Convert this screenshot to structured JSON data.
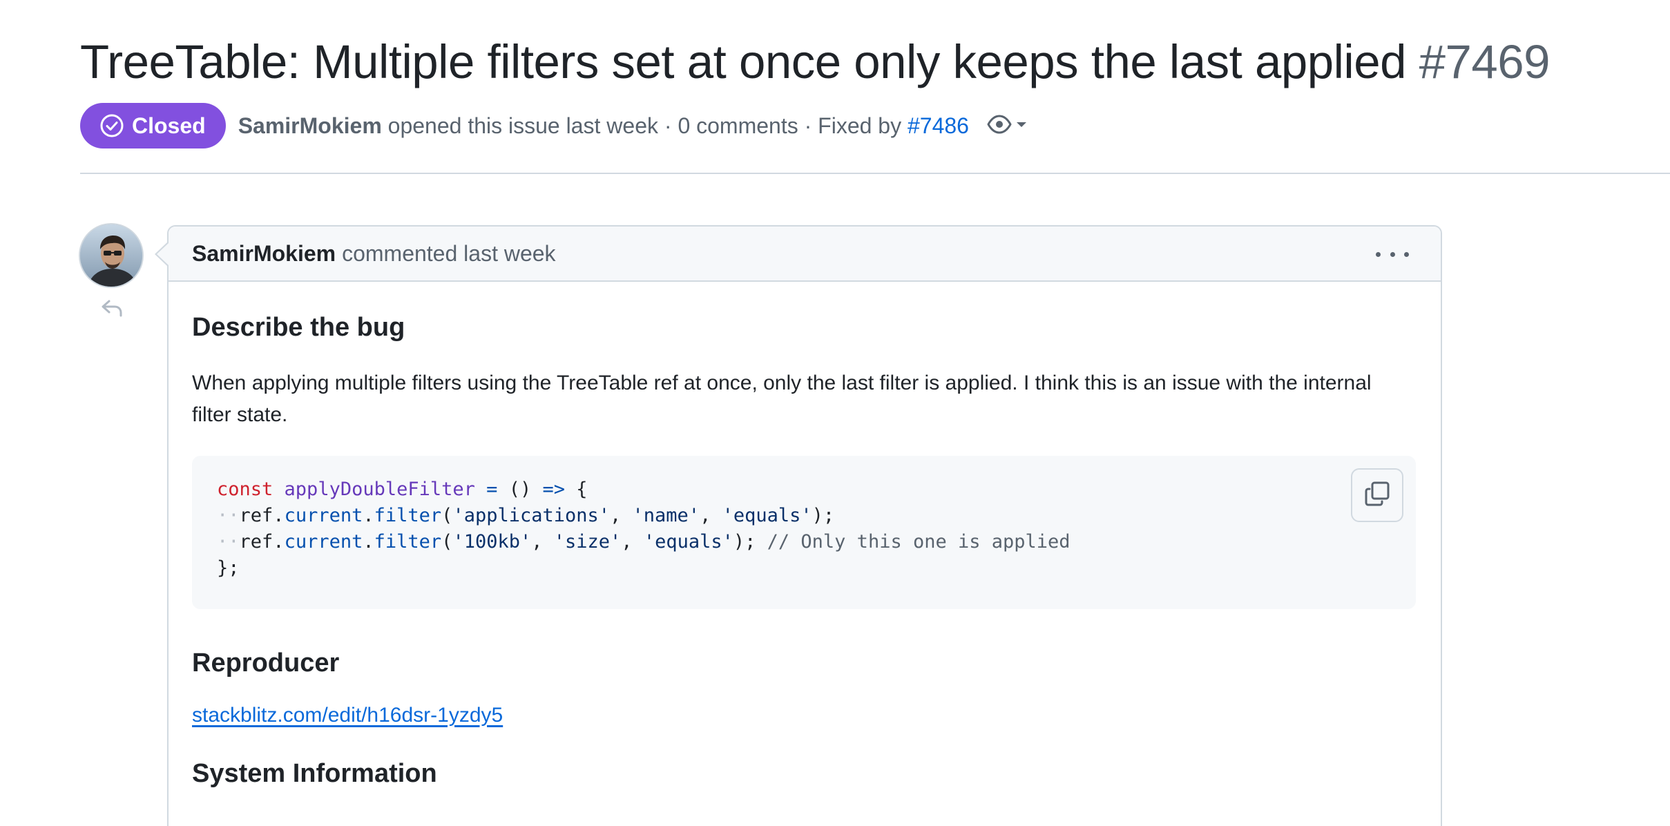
{
  "issue": {
    "title": "TreeTable: Multiple filters set at once only keeps the last applied",
    "number": "#7469",
    "state": "Closed",
    "state_color": "#8250df",
    "author": "SamirMokiem",
    "opened_text": "opened this issue last week",
    "separator": "·",
    "comments_text": "0 comments",
    "fixed_by_label": "Fixed by",
    "fixed_by_pr": "#7486",
    "watch_icon": "eye-icon"
  },
  "comment": {
    "author": "SamirMokiem",
    "meta": "commented last week",
    "menu_icon": "kebab-horizontal-icon",
    "reply_icon": "reply-icon",
    "sections": {
      "describe": {
        "heading": "Describe the bug",
        "text": "When applying multiple filters using the TreeTable ref at once, only the last filter is applied. I think this is an issue with the internal filter state."
      },
      "reproducer": {
        "heading": "Reproducer",
        "link": "stackblitz.com/edit/h16dsr-1yzdy5"
      },
      "system": {
        "heading": "System Information"
      }
    },
    "code": {
      "copy_icon": "copy-icon",
      "line1": {
        "kw": "const",
        "name": "applyDoubleFilter",
        "eq": "=",
        "parens": "()",
        "arrow": "=>",
        "brace": "{"
      },
      "line2": {
        "indent": "··",
        "obj": "ref",
        "dot1": ".",
        "prop": "current",
        "dot2": ".",
        "method": "filter",
        "open": "(",
        "arg1": "'applications'",
        "comma1": ", ",
        "arg2": "'name'",
        "comma2": ", ",
        "arg3": "'equals'",
        "close": ");"
      },
      "line3": {
        "indent": "··",
        "obj": "ref",
        "dot1": ".",
        "prop": "current",
        "dot2": ".",
        "method": "filter",
        "open": "(",
        "arg1": "'100kb'",
        "comma1": ", ",
        "arg2": "'size'",
        "comma2": ", ",
        "arg3": "'equals'",
        "close": ");",
        "comment": "// Only this one is applied"
      },
      "line4": "};"
    }
  }
}
